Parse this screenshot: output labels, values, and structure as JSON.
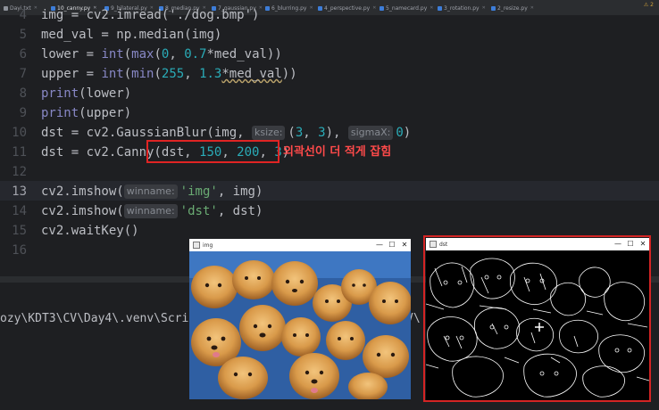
{
  "tabs": [
    {
      "label": "Dayi.txt",
      "icon": "text-file-icon"
    },
    {
      "label": "10_canny.py",
      "icon": "python-file-icon",
      "active": true
    },
    {
      "label": "9_bilateral.py",
      "icon": "python-file-icon"
    },
    {
      "label": "8_median.py",
      "icon": "python-file-icon"
    },
    {
      "label": "7_gaussian.py",
      "icon": "python-file-icon"
    },
    {
      "label": "6_blurring.py",
      "icon": "python-file-icon"
    },
    {
      "label": "4_perspective.py",
      "icon": "python-file-icon"
    },
    {
      "label": "5_namecard.py",
      "icon": "python-file-icon"
    },
    {
      "label": "3_rotation.py",
      "icon": "python-file-icon"
    },
    {
      "label": "2_resize.py",
      "icon": "python-file-icon"
    }
  ],
  "warning_count": "⚠ 2",
  "line_numbers": [
    "4",
    "5",
    "6",
    "7",
    "8",
    "9",
    "10",
    "11",
    "12",
    "13",
    "14",
    "15",
    "16"
  ],
  "code": {
    "l4_partial": "img = cv2.imread('./dog.bmp')",
    "l5_a": "med_val = np.",
    "l5_b": "median",
    "l5_c": "(img)",
    "l6_a": "lower = ",
    "l6_b": "int",
    "l6_c": "(",
    "l6_d": "max",
    "l6_e": "(",
    "l6_f": "0",
    "l6_g": ", ",
    "l6_h": "0.7",
    "l6_i": "*med_val))",
    "l7_a": "upper = ",
    "l7_b": "int",
    "l7_c": "(",
    "l7_d": "min",
    "l7_e": "(",
    "l7_f": "255",
    "l7_g": ", ",
    "l7_h": "1.3",
    "l7_i": "*med_val",
    "l7_j": "))",
    "l8_a": "print",
    "l8_b": "(lower)",
    "l9_a": "print",
    "l9_b": "(upper)",
    "l10_a": "dst = cv2.GaussianBlur(img, ",
    "l10_hint1": "ksize:",
    "l10_b": "(",
    "l10_c": "3",
    "l10_d": ", ",
    "l10_e": "3",
    "l10_f": "), ",
    "l10_hint2": "sigmaX:",
    "l10_g": "0",
    "l10_h": ")",
    "l11_a": "dst = cv2.Canny(dst, ",
    "l11_b": "150",
    "l11_c": ", ",
    "l11_d": "200",
    "l11_e": ", ",
    "l11_f": "3",
    "l11_g": ")",
    "l13_a": "cv2.imshow(",
    "l13_hint": "winname:",
    "l13_b": "'img'",
    "l13_c": ", img)",
    "l14_a": "cv2.imshow(",
    "l14_hint": "winname:",
    "l14_b": "'dst'",
    "l14_c": ", dst)",
    "l15_a": "cv2.waitKey()"
  },
  "annotation": "외곽선이 더 적게 잡힘",
  "terminal_text": "ozy\\KDT3\\CV\\Day4\\.venv\\Scri",
  "terminal_tail": "V\\",
  "window_img": {
    "title": "img",
    "min": "—",
    "max": "☐",
    "close": "✕"
  },
  "window_dst": {
    "title": "dst",
    "min": "—",
    "max": "☐",
    "close": "✕"
  },
  "colors": {
    "highlight_box": "#e02424",
    "annotation": "#ff4a4a"
  }
}
